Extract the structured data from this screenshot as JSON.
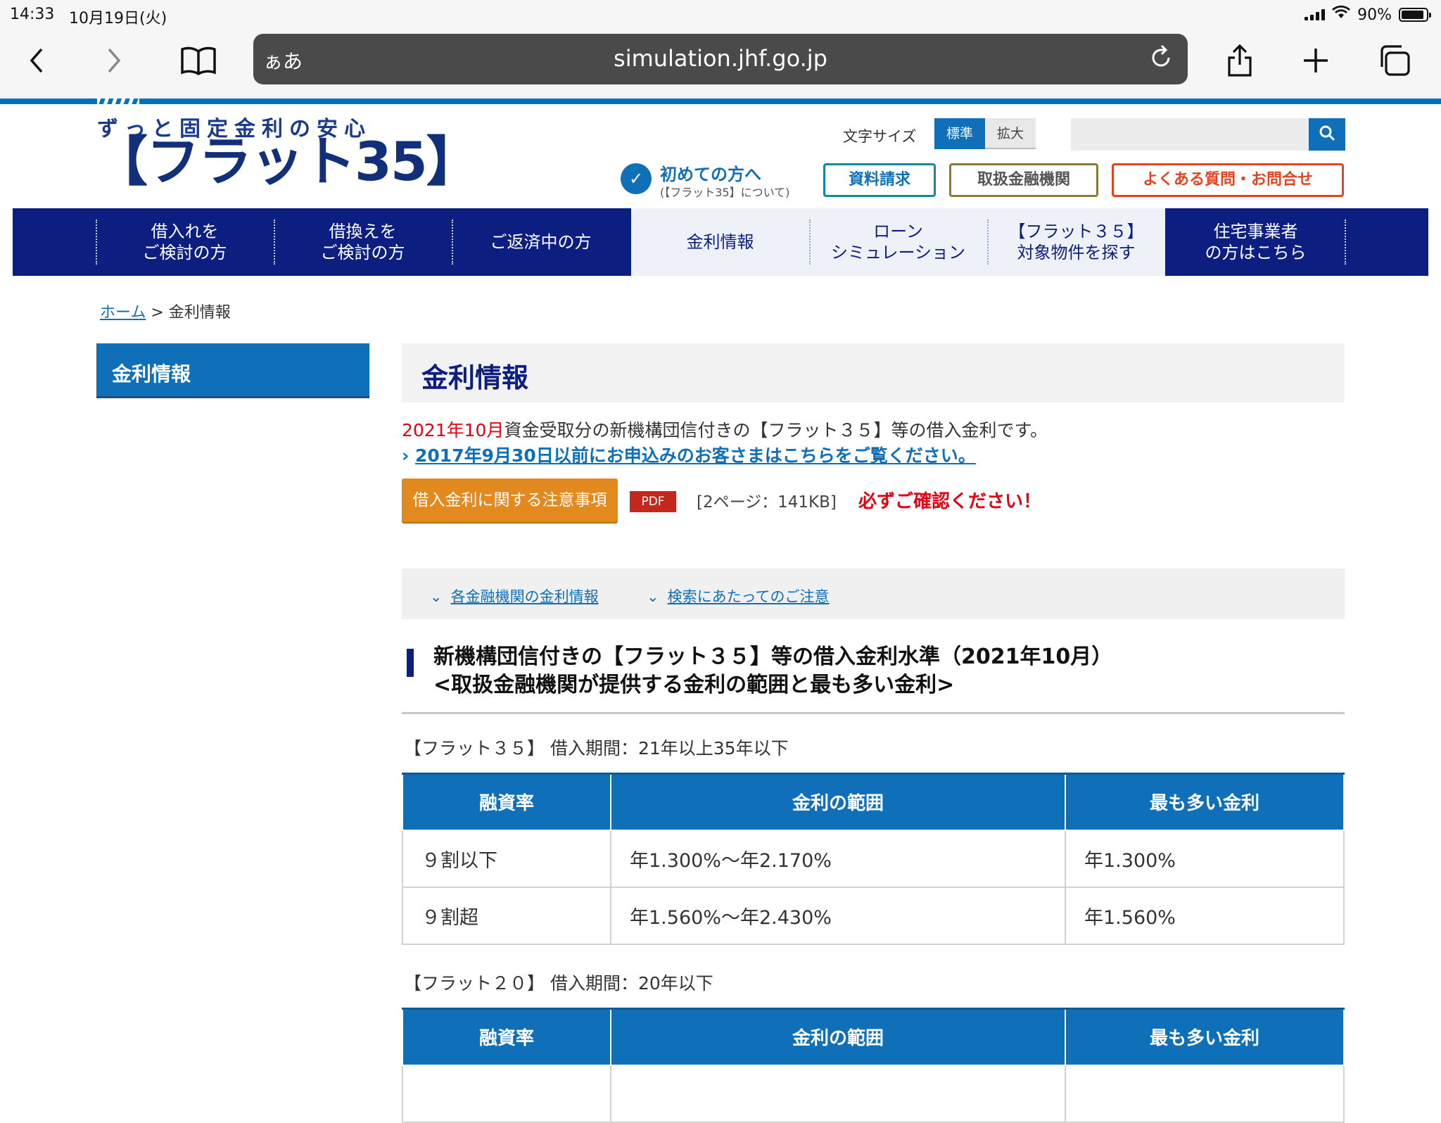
{
  "status": {
    "time": "14:33",
    "date": "10月19日(火)",
    "battery": "90%"
  },
  "browser": {
    "aa_label": "ぁあ",
    "url": "simulation.jhf.go.jp"
  },
  "header": {
    "logo_top": "ずっと固定金利の安心",
    "logo_main": "【フラット35】",
    "font_size_label": "文字サイズ",
    "font_std": "標準",
    "font_big": "拡大",
    "first_main": "初めての方へ",
    "first_sub": "(【フラット35】について)",
    "btn_docs": "資料請求",
    "btn_banks": "取扱金融機関",
    "btn_faq": "よくある質問・お問合せ"
  },
  "gnav": [
    {
      "label": "借入れを\nご検討の方"
    },
    {
      "label": "借換えを\nご検討の方"
    },
    {
      "label": "ご返済中の方"
    },
    {
      "label": "金利情報"
    },
    {
      "label": "ローン\nシミュレーション"
    },
    {
      "label": "【フラット３５】\n対象物件を探す"
    },
    {
      "label": "住宅事業者\nの方はこちら"
    }
  ],
  "breadcrumb": {
    "home": "ホーム",
    "sep": " > ",
    "current": "金利情報"
  },
  "sidebar": {
    "title": "金利情報"
  },
  "main": {
    "title": "金利情報",
    "intro_red": "2021年10月",
    "intro_rest": "資金受取分の新機構団信付きの【フラット３５】等の借入金利です。",
    "old_link": "2017年9月30日以前にお申込みのお客さまはこちらをご覧ください。",
    "notice_btn": "借入金利に関する注意事項",
    "pdf": "PDF",
    "pdf_info": "[2ページ：141KB]",
    "must": "必ずご確認ください！",
    "anchor1": "各金融機関の金利情報",
    "anchor2": "検索にあたってのご注意",
    "h2_line1": "新機構団信付きの【フラット３５】等の借入金利水準（2021年10月）",
    "h2_line2": "<取扱金融機関が提供する金利の範囲と最も多い金利>",
    "table1": {
      "caption": "【フラット３５】 借入期間：21年以上35年以下",
      "headers": [
        "融資率",
        "金利の範囲",
        "最も多い金利"
      ],
      "rows": [
        [
          "９割以下",
          "年1.300%～年2.170%",
          "年1.300%"
        ],
        [
          "９割超",
          "年1.560%～年2.430%",
          "年1.560%"
        ]
      ]
    },
    "table2": {
      "caption": "【フラット２０】 借入期間：20年以下",
      "headers": [
        "融資率",
        "金利の範囲",
        "最も多い金利"
      ]
    }
  },
  "colors": {
    "brand_navy": "#0c1e7f",
    "brand_blue": "#0f6fb8",
    "accent_orange": "#e38a1f",
    "alert_red": "#e60012"
  }
}
